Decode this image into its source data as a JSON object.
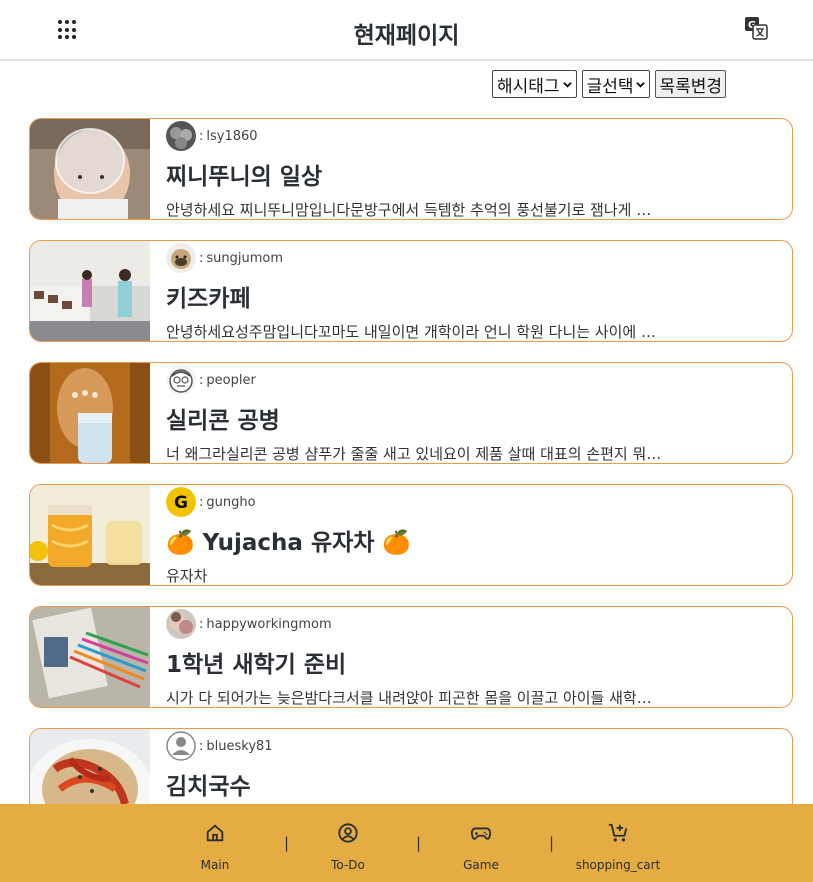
{
  "header": {
    "title": "현재페이지",
    "menu_icon": "apps-grid-icon",
    "translate_icon": "translate-icon"
  },
  "controls": {
    "hashtag_select": "해시태그",
    "post_select": "글선택",
    "change_button": "목록변경"
  },
  "posts": [
    {
      "author": "lsy1860",
      "title": "찌니뚜니의 일상",
      "excerpt": "안녕하세요 찌니뚜니맘입니다문방구에서 득템한 추억의 풍선불기로 잼나게 …"
    },
    {
      "author": "sungjumom",
      "title": "키즈카페",
      "excerpt": "안녕하세요성주맘입니다꼬마도 내일이면 개학이라 언니 학원 다니는 사이에 …"
    },
    {
      "author": "peopler",
      "title": "실리콘 공병",
      "excerpt": "너 왜그라실리콘 공병 샴푸가 줄줄 새고 있네요이 제품 살때 대표의 손편지 뭐…"
    },
    {
      "author": "gungho",
      "title": "🍊 Yujacha 유자차 🍊",
      "excerpt": "유자차"
    },
    {
      "author": "happyworkingmom",
      "title": "1학년 새학기 준비",
      "excerpt": "시가 다 되어가는 늦은밤다크서클 내려앉아 피곤한 몸을 이끌고 아이들 새학…"
    },
    {
      "author": "bluesky81",
      "title": "김치국수",
      "excerpt": ""
    }
  ],
  "author_separator": ":",
  "bottom_nav": [
    {
      "label": "Main",
      "icon": "home-icon"
    },
    {
      "label": "To-Do",
      "icon": "user-circle-icon"
    },
    {
      "label": "Game",
      "icon": "gamepad-icon"
    },
    {
      "label": "shopping_cart",
      "icon": "add-cart-icon"
    }
  ],
  "nav_separator": "|",
  "colors": {
    "accent_border": "#e89a4e",
    "bottom_nav": "#e6ac44",
    "title_text": "#2a2f36"
  }
}
